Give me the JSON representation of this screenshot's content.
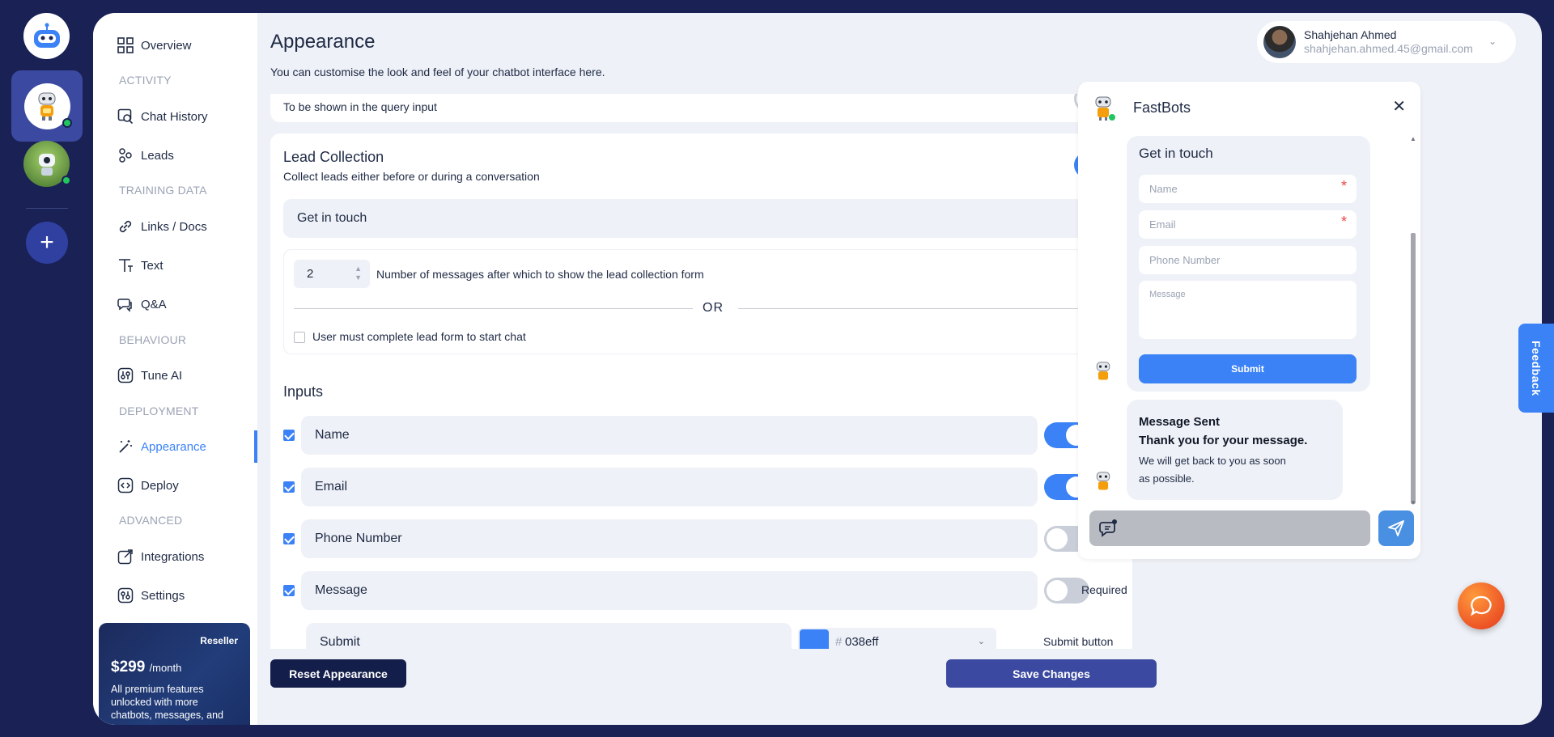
{
  "sidebar": {
    "items": [
      {
        "label": "Overview"
      },
      {
        "label": "Chat History"
      },
      {
        "label": "Leads"
      },
      {
        "label": "Links / Docs"
      },
      {
        "label": "Text"
      },
      {
        "label": "Q&A"
      },
      {
        "label": "Tune AI"
      },
      {
        "label": "Appearance"
      },
      {
        "label": "Deploy"
      },
      {
        "label": "Integrations"
      },
      {
        "label": "Settings"
      }
    ],
    "sections": {
      "activity": "ACTIVITY",
      "training": "TRAINING DATA",
      "behaviour": "BEHAVIOUR",
      "deployment": "DEPLOYMENT",
      "advanced": "ADVANCED"
    },
    "promo": {
      "badge": "Reseller",
      "price": "$299",
      "period": "/month",
      "text": "All premium features unlocked with more chatbots, messages, and"
    }
  },
  "header": {
    "title": "Appearance",
    "subtitle": "You can customise the look and feel of your chatbot interface here."
  },
  "user": {
    "name": "Shahjehan Ahmed",
    "email": "shahjehan.ahmed.45@gmail.com"
  },
  "query_card": {
    "text": "To be shown in the query input",
    "toggle_on": false
  },
  "lead_collection": {
    "title": "Lead Collection",
    "subtitle": "Collect leads either before or during a conversation",
    "enabled": true,
    "form_title": "Get in touch",
    "message_count": "2",
    "message_count_label": "Number of messages after which to show the lead collection form",
    "or_text": "OR",
    "must_complete_label": "User must complete lead form to start chat",
    "must_complete": false,
    "inputs_title": "Inputs",
    "required_label": "Required",
    "inputs": [
      {
        "label": "Name",
        "checked": true,
        "required": true
      },
      {
        "label": "Email",
        "checked": true,
        "required": true
      },
      {
        "label": "Phone Number",
        "checked": true,
        "required": false
      },
      {
        "label": "Message",
        "checked": true,
        "required": false
      }
    ],
    "submit_label": "Submit",
    "submit_color_hash": "#",
    "submit_color_hex": "038eff",
    "submit_color_label": "Submit button color"
  },
  "actions": {
    "reset_label": "Reset Appearance",
    "save_label": "Save Changes"
  },
  "chat_preview": {
    "title": "FastBots",
    "form_title": "Get in touch",
    "name_placeholder": "Name",
    "email_placeholder": "Email",
    "phone_placeholder": "Phone Number",
    "message_placeholder": "Message",
    "submit_label": "Submit",
    "sent_title": "Message Sent",
    "sent_thanks": "Thank you for your message.",
    "sent_text": "We will get back to you as soon as possible."
  },
  "feedback_label": "Feedback",
  "colors": {
    "accent": "#3b82f6",
    "navy": "#1a2155",
    "submit": "#038eff"
  }
}
